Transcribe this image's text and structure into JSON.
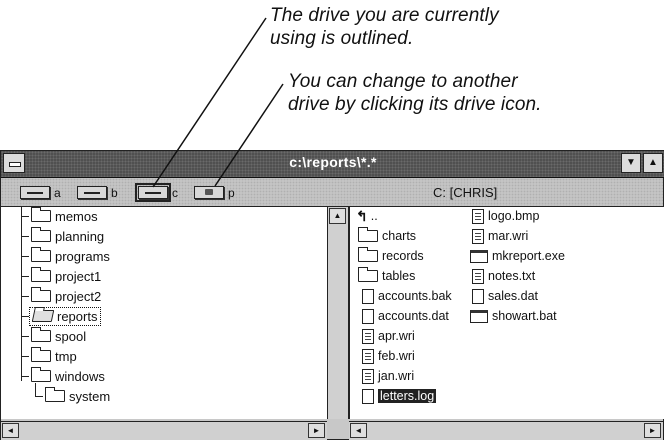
{
  "callouts": {
    "first": [
      "The drive you are currently",
      "using is outlined."
    ],
    "second": [
      "You can change to another",
      "drive by clicking its drive icon."
    ]
  },
  "window": {
    "title": "c:\\reports\\*.*",
    "volume_label": "C: [CHRIS]"
  },
  "drives": [
    {
      "letter": "a",
      "icon": "floppy-drive-icon"
    },
    {
      "letter": "b",
      "icon": "floppy-drive-icon"
    },
    {
      "letter": "c",
      "icon": "hard-drive-icon",
      "current": true
    },
    {
      "letter": "p",
      "icon": "network-drive-icon"
    }
  ],
  "tree": [
    {
      "name": "memos"
    },
    {
      "name": "planning"
    },
    {
      "name": "programs"
    },
    {
      "name": "project1"
    },
    {
      "name": "project2"
    },
    {
      "name": "reports",
      "selected": true
    },
    {
      "name": "spool"
    },
    {
      "name": "tmp"
    },
    {
      "name": "windows"
    },
    {
      "name": "system"
    }
  ],
  "files_col1": [
    {
      "name": "..",
      "icon": "up-directory-icon"
    },
    {
      "name": "charts",
      "icon": "folder-icon"
    },
    {
      "name": "records",
      "icon": "folder-icon"
    },
    {
      "name": "tables",
      "icon": "folder-icon"
    },
    {
      "name": "accounts.bak",
      "icon": "file-icon"
    },
    {
      "name": "accounts.dat",
      "icon": "file-icon"
    },
    {
      "name": "apr.wri",
      "icon": "document-icon"
    },
    {
      "name": "feb.wri",
      "icon": "document-icon"
    },
    {
      "name": "jan.wri",
      "icon": "document-icon"
    },
    {
      "name": "letters.log",
      "icon": "file-icon",
      "selected": true
    }
  ],
  "files_col2": [
    {
      "name": "logo.bmp",
      "icon": "document-icon"
    },
    {
      "name": "mar.wri",
      "icon": "document-icon"
    },
    {
      "name": "mkreport.exe",
      "icon": "program-icon"
    },
    {
      "name": "notes.txt",
      "icon": "document-icon"
    },
    {
      "name": "sales.dat",
      "icon": "file-icon"
    },
    {
      "name": "showart.bat",
      "icon": "program-icon"
    }
  ],
  "colors": {
    "titlebar": "#505050",
    "window_bg": "#c8c8c8"
  }
}
